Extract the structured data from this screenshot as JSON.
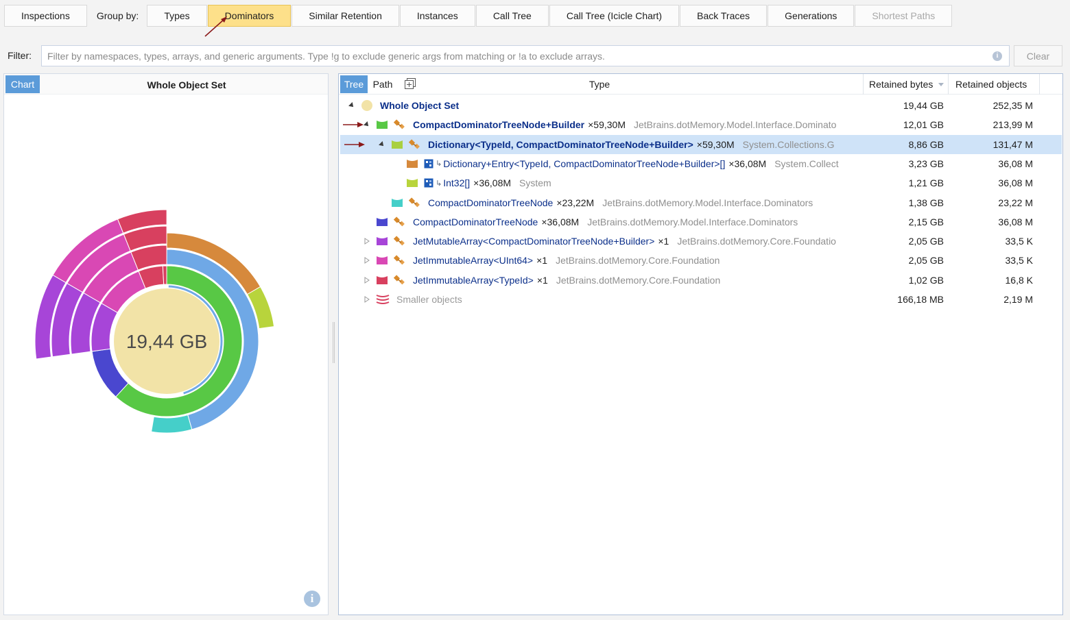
{
  "toolbar": {
    "inspections": "Inspections",
    "group_by_label": "Group by:",
    "tabs": [
      {
        "label": "Types",
        "state": "normal"
      },
      {
        "label": "Dominators",
        "state": "active"
      },
      {
        "label": "Similar Retention",
        "state": "normal"
      },
      {
        "label": "Instances",
        "state": "normal"
      },
      {
        "label": "Call Tree",
        "state": "normal"
      },
      {
        "label": "Call Tree (Icicle Chart)",
        "state": "normal"
      },
      {
        "label": "Back Traces",
        "state": "normal"
      },
      {
        "label": "Generations",
        "state": "normal"
      },
      {
        "label": "Shortest Paths",
        "state": "disabled"
      }
    ]
  },
  "filter": {
    "label": "Filter:",
    "placeholder": "Filter by namespaces, types, arrays, and generic arguments. Type !g to exclude generic args from matching or !a to exclude arrays.",
    "value": "",
    "info_icon": "i",
    "clear_label": "Clear"
  },
  "chart_panel": {
    "tab_label": "Chart",
    "title": "Whole Object Set",
    "center_label": "19,44 GB",
    "info_icon": "i"
  },
  "tree": {
    "tabs": {
      "tree": "Tree",
      "path": "Path"
    },
    "columns": {
      "type": "Type",
      "retained_bytes": "Retained bytes",
      "retained_objects": "Retained objects"
    },
    "rows": [
      {
        "name": "Whole Object Set",
        "count": "",
        "ns": "",
        "bytes": "19,44 GB",
        "objects": "252,35 M",
        "color": "#f2e3a7",
        "icon": "circle",
        "expander": "open",
        "bold": true,
        "indent": 0,
        "arrow": false,
        "selected": false
      },
      {
        "name": "CompactDominatorTreeNode+Builder",
        "count": "×59,30M",
        "ns": "JetBrains.dotMemory.Model.Interface.Dominato",
        "bytes": "12,01 GB",
        "objects": "213,99 M",
        "color": "#58c845",
        "icon": "class",
        "expander": "open",
        "bold": true,
        "indent": 1,
        "arrow": true,
        "selected": false
      },
      {
        "name": "Dictionary<TypeId, CompactDominatorTreeNode+Builder>",
        "count": "×59,30M",
        "ns": "System.Collections.G",
        "bytes": "8,86 GB",
        "objects": "131,47 M",
        "color": "#a9d040",
        "icon": "class",
        "expander": "open",
        "bold": true,
        "indent": 2,
        "arrow": true,
        "selected": true
      },
      {
        "name": "Dictionary+Entry<TypeId, CompactDominatorTreeNode+Builder>[]",
        "count": "×36,08M",
        "ns": "System.Collect",
        "bytes": "3,23 GB",
        "objects": "36,08 M",
        "color": "#d6893c",
        "icon": "struct",
        "expander": "none",
        "bold": false,
        "indent": 3,
        "arrow": false,
        "selected": false
      },
      {
        "name": "Int32[]",
        "count": "×36,08M",
        "ns": "System",
        "bytes": "1,21 GB",
        "objects": "36,08 M",
        "color": "#b8d43c",
        "icon": "struct",
        "expander": "none",
        "bold": false,
        "indent": 3,
        "arrow": false,
        "selected": false
      },
      {
        "name": "CompactDominatorTreeNode",
        "count": "×23,22M",
        "ns": "JetBrains.dotMemory.Model.Interface.Dominators",
        "bytes": "1,38 GB",
        "objects": "23,22 M",
        "color": "#45cfc9",
        "icon": "class",
        "expander": "none",
        "bold": false,
        "indent": 2,
        "arrow": false,
        "selected": false
      },
      {
        "name": "CompactDominatorTreeNode",
        "count": "×36,08M",
        "ns": "JetBrains.dotMemory.Model.Interface.Dominators",
        "bytes": "2,15 GB",
        "objects": "36,08 M",
        "color": "#4a47cf",
        "icon": "class",
        "expander": "none",
        "bold": false,
        "indent": 1,
        "arrow": false,
        "selected": false
      },
      {
        "name": "JetMutableArray<CompactDominatorTreeNode+Builder>",
        "count": "×1",
        "ns": "JetBrains.dotMemory.Core.Foundatio",
        "bytes": "2,05 GB",
        "objects": "33,5 K",
        "color": "#a745d8",
        "icon": "class",
        "expander": "closed",
        "bold": false,
        "indent": 1,
        "arrow": false,
        "selected": false
      },
      {
        "name": "JetImmutableArray<UInt64>",
        "count": "×1",
        "ns": "JetBrains.dotMemory.Core.Foundation",
        "bytes": "2,05 GB",
        "objects": "33,5 K",
        "color": "#d948b4",
        "icon": "class",
        "expander": "closed",
        "bold": false,
        "indent": 1,
        "arrow": false,
        "selected": false
      },
      {
        "name": "JetImmutableArray<TypeId>",
        "count": "×1",
        "ns": "JetBrains.dotMemory.Core.Foundation",
        "bytes": "1,02 GB",
        "objects": "16,8 K",
        "color": "#d8405f",
        "icon": "class",
        "expander": "closed",
        "bold": false,
        "indent": 1,
        "arrow": false,
        "selected": false
      },
      {
        "name": "Smaller objects",
        "count": "",
        "ns": "",
        "bytes": "166,18 MB",
        "objects": "2,19 M",
        "color": "#d8405f",
        "icon": "stack",
        "expander": "closed",
        "bold": false,
        "indent": 1,
        "arrow": false,
        "selected": false,
        "gray": true
      }
    ]
  },
  "colors": {
    "accent": "#5b9bd9",
    "active_tab": "#fde08a",
    "selection": "#cfe3f8",
    "annotation_arrow": "#8b1a1a"
  }
}
